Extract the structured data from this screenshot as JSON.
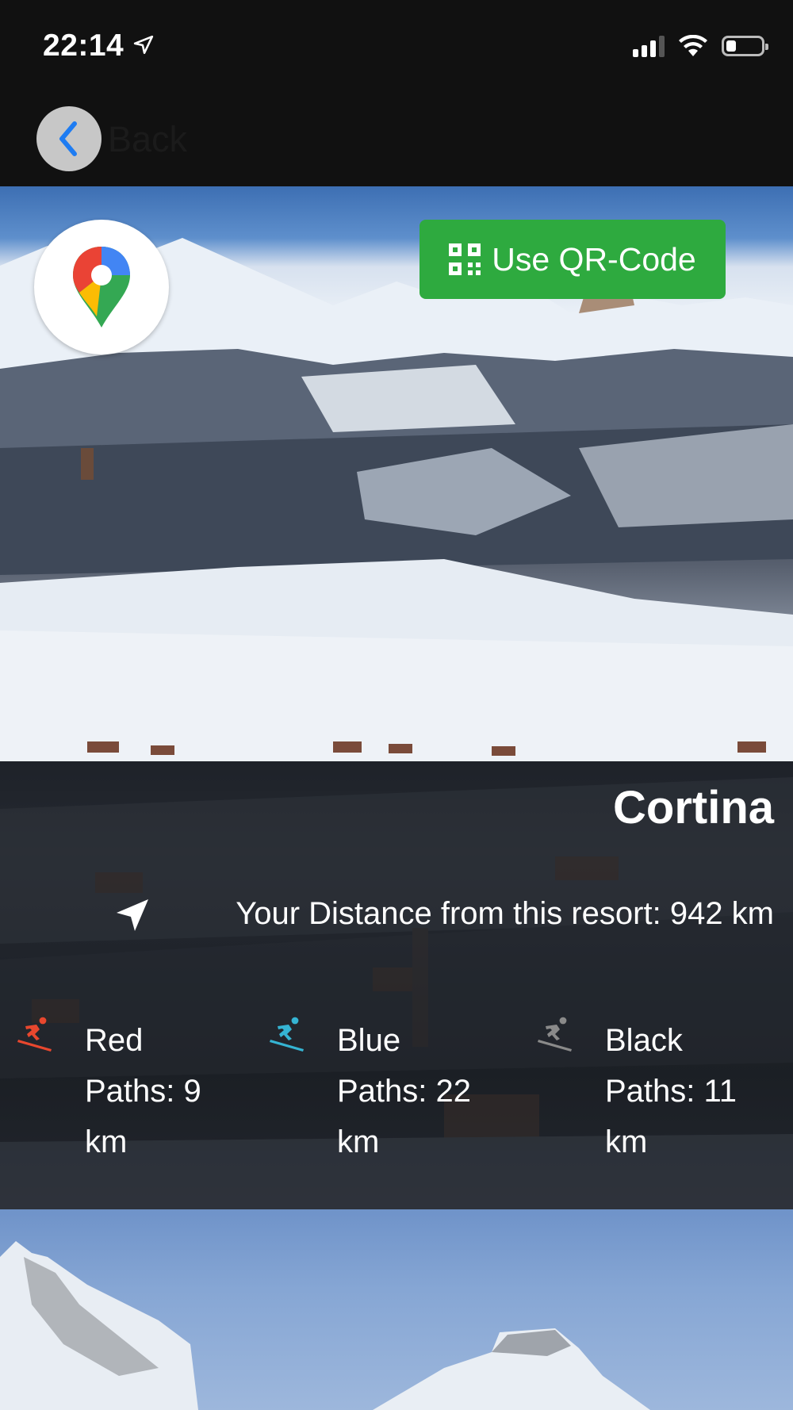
{
  "status_bar": {
    "time": "22:14",
    "icons": [
      "location-arrow-icon",
      "cellular-signal-icon",
      "wifi-icon",
      "battery-icon"
    ]
  },
  "nav": {
    "back_label": "Back",
    "back_icon": "chevron-left-icon"
  },
  "hero": {
    "maps_icon": "google-maps-pin-icon",
    "qr_button": {
      "label": "Use QR-Code",
      "icon": "qr-code-icon",
      "color": "#2eaa3f"
    }
  },
  "resort": {
    "name": "Cortina",
    "distance_text": "Your Distance from this resort: 942 km",
    "distance_icon": "navigation-arrow-icon",
    "paths": [
      {
        "color_name": "Red",
        "line1": "Red",
        "line2": "Paths: 9",
        "line3": "km",
        "icon": "skier-icon",
        "icon_color": "#e8472e"
      },
      {
        "color_name": "Blue",
        "line1": "Blue",
        "line2": "Paths: 22",
        "line3": "km",
        "icon": "skier-icon",
        "icon_color": "#35b4d3"
      },
      {
        "color_name": "Black",
        "line1": "Black",
        "line2": "Paths: 11",
        "line3": "km",
        "icon": "skier-icon",
        "icon_color": "#8a8a8a"
      }
    ]
  },
  "colors": {
    "background": "#111111",
    "accent_green": "#2eaa3f",
    "back_button_bg": "#c7c7c7",
    "ios_blue": "#1e7cf2"
  }
}
